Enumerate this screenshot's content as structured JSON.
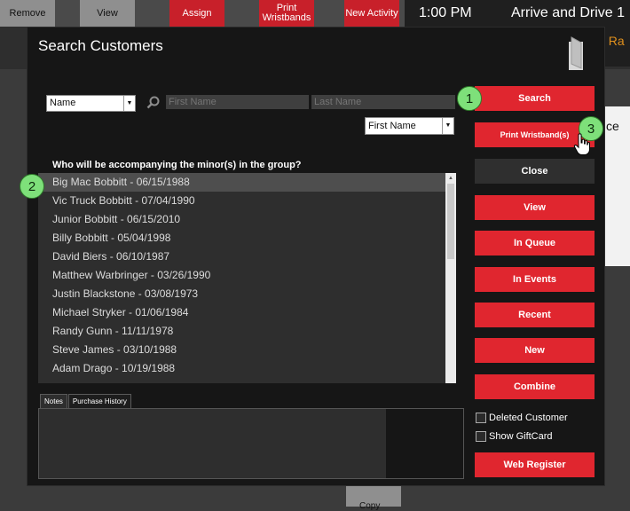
{
  "background": {
    "toolbar_buttons": [
      "Remove",
      "View",
      "Assign",
      "Print Wristbands",
      "New Activity"
    ],
    "time": "1:00 PM",
    "title": "Arrive and Drive 1",
    "orange_text": "t Ra",
    "card_text": "ce",
    "bottom_button": "Copy"
  },
  "dialog": {
    "title": "Search Customers",
    "search_by": "Name",
    "first_name_placeholder": "First Name",
    "last_name_placeholder": "Last Name",
    "sort_by": "First Name",
    "prompt": "Who will be accompanying the minor(s) in the group?",
    "customers": [
      "Big Mac Bobbitt - 06/15/1988",
      "Vic Truck Bobbitt - 07/04/1990",
      "Junior Bobbitt - 06/15/2010",
      "Billy Bobbitt - 05/04/1998",
      "David Biers - 06/10/1987",
      "Matthew Warbringer - 03/26/1990",
      "Justin Blackstone - 03/08/1973",
      "Michael Stryker - 01/06/1984",
      "Randy Gunn - 11/11/1978",
      "Steve James - 03/10/1988",
      "Adam Drago - 10/19/1988"
    ],
    "tabs": [
      "Notes",
      "Purchase History"
    ],
    "buttons": {
      "search": "Search",
      "print_wristbands": "Print Wristband(s)",
      "close": "Close",
      "view": "View",
      "in_queue": "In Queue",
      "in_events": "In Events",
      "recent": "Recent",
      "new": "New",
      "combine": "Combine",
      "web_register": "Web Register"
    },
    "checkboxes": {
      "deleted_customer": "Deleted Customer",
      "show_giftcard": "Show GiftCard"
    }
  },
  "markers": [
    "1",
    "2",
    "3"
  ],
  "colors": {
    "accent_red": "#e0262f",
    "marker_green": "#7ee07a"
  }
}
